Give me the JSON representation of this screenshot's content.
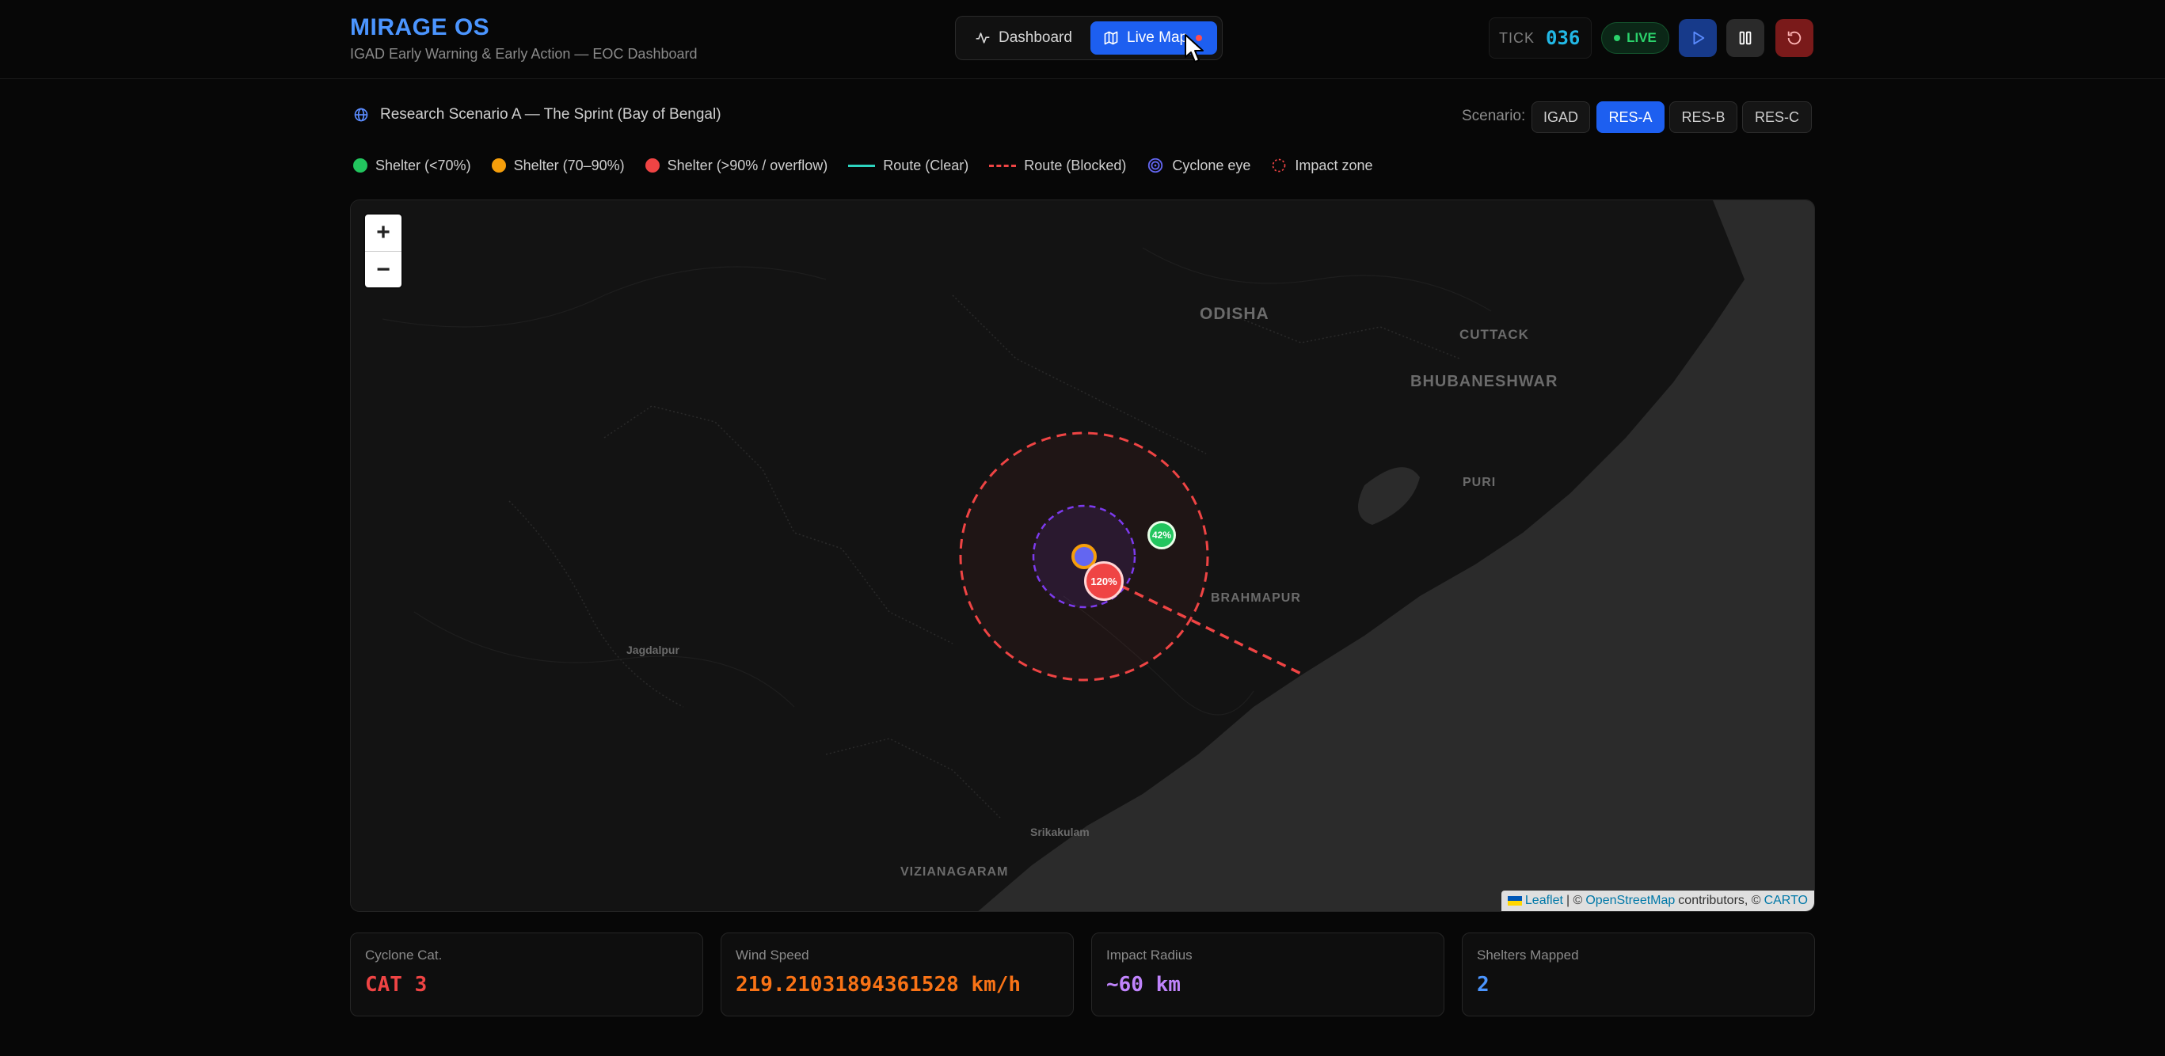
{
  "header": {
    "title": "MIRAGE OS",
    "subtitle": "IGAD Early Warning & Early Action — EOC Dashboard",
    "tabs": [
      {
        "label": "Dashboard",
        "icon": "activity-icon"
      },
      {
        "label": "Live Map",
        "icon": "map-icon"
      }
    ],
    "tick_label": "TICK",
    "tick_value": "036",
    "live_label": "LIVE",
    "colors": {
      "brand": "#4b95ff",
      "accent": "#1d5ff0",
      "live": "#2bd26b",
      "tick": "#22b8e6"
    }
  },
  "scenario": {
    "title": "Research Scenario A — The Sprint (Bay of Bengal)",
    "label": "Scenario:",
    "options": [
      "IGAD",
      "RES-A",
      "RES-B",
      "RES-C"
    ],
    "selected": "RES-A"
  },
  "legend": [
    {
      "label": "Shelter (<70%)",
      "color": "#22c55e"
    },
    {
      "label": "Shelter (70–90%)",
      "color": "#f59e0b"
    },
    {
      "label": "Shelter (>90% / overflow)",
      "color": "#ef4444"
    },
    {
      "label": "Route (Clear)",
      "color": "#2dd4bf"
    },
    {
      "label": "Route (Blocked)",
      "color": "#ef4444"
    },
    {
      "label": "Cyclone eye",
      "color": "#6366f1"
    },
    {
      "label": "Impact zone",
      "color": "#ef4444"
    }
  ],
  "map": {
    "labels": [
      "ODISHA",
      "CUTTACK",
      "BHUBANESHWAR",
      "PURI",
      "BRAHMAPUR",
      "Jagdalpur",
      "Srikakulam",
      "VIZIANAGARAM"
    ],
    "shelters": [
      {
        "label": "42%",
        "color": "#22c55e"
      },
      {
        "label": "120%",
        "color": "#ef4444"
      }
    ],
    "zoom_in": "+",
    "zoom_out": "−",
    "attribution": {
      "leaflet": "Leaflet",
      "separator": "| ©",
      "osm": "OpenStreetMap",
      "contrib": "contributors, ©",
      "carto": "CARTO"
    }
  },
  "stats": [
    {
      "label": "Cyclone Cat.",
      "value": "CAT 3",
      "color": "#ef4444"
    },
    {
      "label": "Wind Speed",
      "value": "219.21031894361528 km/h",
      "color": "#f97316"
    },
    {
      "label": "Impact Radius",
      "value": "~60 km",
      "color": "#c084fc"
    },
    {
      "label": "Shelters Mapped",
      "value": "2",
      "color": "#4b95ff"
    }
  ]
}
